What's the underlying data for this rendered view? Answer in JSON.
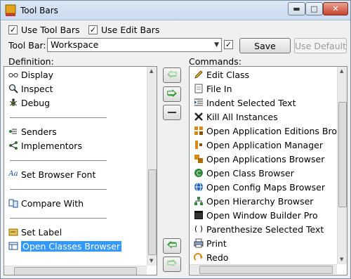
{
  "window": {
    "title": "Tool Bars",
    "minimize_icon": "minimize-icon",
    "maximize_icon": "maximize-icon",
    "close_icon": "close-icon"
  },
  "options": {
    "use_tool_bars": {
      "label": "Use Tool Bars",
      "checked": true
    },
    "use_edit_bars": {
      "label": "Use Edit Bars",
      "checked": true
    }
  },
  "toolbar_select": {
    "label": "Tool Bar:",
    "value": "Workspace",
    "extra_checkbox_checked": true
  },
  "buttons": {
    "save": "Save",
    "use_default": "Use Default"
  },
  "definition": {
    "label": "Definition:",
    "items": [
      {
        "label": "Display",
        "icon": "glasses-icon"
      },
      {
        "label": "Inspect",
        "icon": "magnifier-icon"
      },
      {
        "label": "Debug",
        "icon": "bug-icon"
      },
      {
        "label": "Senders",
        "icon": "senders-icon"
      },
      {
        "label": "Implementors",
        "icon": "implementors-icon"
      },
      {
        "label": "Set Browser Font",
        "icon": "font-icon"
      },
      {
        "label": "Compare With",
        "icon": "compare-icon"
      },
      {
        "label": "Set Label",
        "icon": "label-icon"
      },
      {
        "label": "Open Classes Browser",
        "icon": "classes-browser-icon",
        "selected": true
      }
    ]
  },
  "commands": {
    "label": "Commands:",
    "items": [
      {
        "label": "Edit Class",
        "icon": "pencil-icon"
      },
      {
        "label": "File In",
        "icon": "file-in-icon"
      },
      {
        "label": "Indent Selected Text",
        "icon": "indent-icon"
      },
      {
        "label": "Kill All Instances",
        "icon": "kill-icon"
      },
      {
        "label": "Open Application Editions Browse",
        "icon": "editions-icon"
      },
      {
        "label": "Open Application Manager",
        "icon": "app-manager-icon"
      },
      {
        "label": "Open Applications Browser",
        "icon": "apps-browser-icon"
      },
      {
        "label": "Open Class Browser",
        "icon": "class-browser-icon"
      },
      {
        "label": "Open Config Maps Browser",
        "icon": "config-maps-icon"
      },
      {
        "label": "Open Hierarchy Browser",
        "icon": "hierarchy-icon"
      },
      {
        "label": "Open Window Builder Pro",
        "icon": "window-builder-icon"
      },
      {
        "label": "Parenthesize Selected Text",
        "icon": "parentheses-icon"
      },
      {
        "label": "Print",
        "icon": "printer-icon"
      },
      {
        "label": "Redo",
        "icon": "redo-icon"
      }
    ]
  },
  "transfer_buttons": {
    "add_icon": "arrow-left-icon",
    "remove_icon": "arrow-right-icon",
    "separator_icon": "separator-icon",
    "move_up_icon": "arrow-up-icon",
    "move_down_icon": "arrow-down-icon"
  },
  "colors": {
    "selection": "#3399ff",
    "arrow_green": "#2e9a2e",
    "arrow_green_disabled": "#8fd08f"
  }
}
